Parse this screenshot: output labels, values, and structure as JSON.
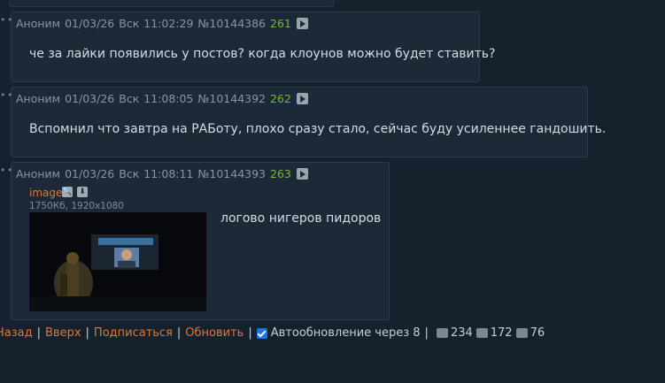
{
  "posts": [
    {
      "author": "Аноним",
      "date": "01/03/26",
      "weekday": "Вск",
      "time": "11:02:29",
      "number": "№10144386",
      "reply_index": "261",
      "text": "че за лайки появились у постов? когда клоунов можно будет ставить?"
    },
    {
      "author": "Аноним",
      "date": "01/03/26",
      "weekday": "Вск",
      "time": "11:08:05",
      "number": "№10144392",
      "reply_index": "262",
      "text": "Вспомнил что завтра на РАБоту, плохо сразу стало, сейчас буду усиленнее гандошить."
    },
    {
      "author": "Аноним",
      "date": "01/03/26",
      "weekday": "Вск",
      "time": "11:08:11",
      "number": "№10144393",
      "reply_index": "263",
      "file_name": "image",
      "file_meta": "1750Кб, 1920x1080",
      "text": "логово нигеров пидоров"
    }
  ],
  "footer": {
    "back": "Назад",
    "up": "Вверх",
    "subscribe": "Подписаться",
    "refresh": "Обновить",
    "auto_update": "Автообновление через 8",
    "posts_count": "234",
    "images_count": "172",
    "posters_count": "76"
  }
}
